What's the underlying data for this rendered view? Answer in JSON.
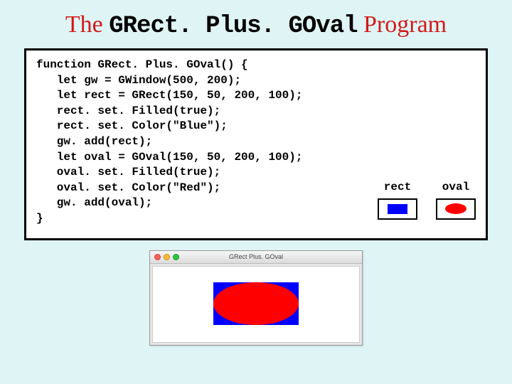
{
  "title": {
    "prefix": "The ",
    "mono": "GRect. Plus. GOval",
    "suffix": " Program"
  },
  "code": {
    "l0": "function GRect. Plus. GOval() {",
    "l1": "   let gw = GWindow(500, 200);",
    "l2": "   let rect = GRect(150, 50, 200, 100);",
    "l3": "   rect. set. Filled(true);",
    "l4": "   rect. set. Color(\"Blue\");",
    "l5": "   gw. add(rect);",
    "l6": "   let oval = GOval(150, 50, 200, 100);",
    "l7": "   oval. set. Filled(true);",
    "l8": "   oval. set. Color(\"Red\");",
    "l9": "   gw. add(oval);",
    "l10": "}"
  },
  "legend": {
    "rect_label": "rect",
    "oval_label": "oval"
  },
  "window": {
    "title": "GRect Plus. GOval"
  },
  "colors": {
    "rect": "#0000ff",
    "oval": "#ff0000"
  }
}
